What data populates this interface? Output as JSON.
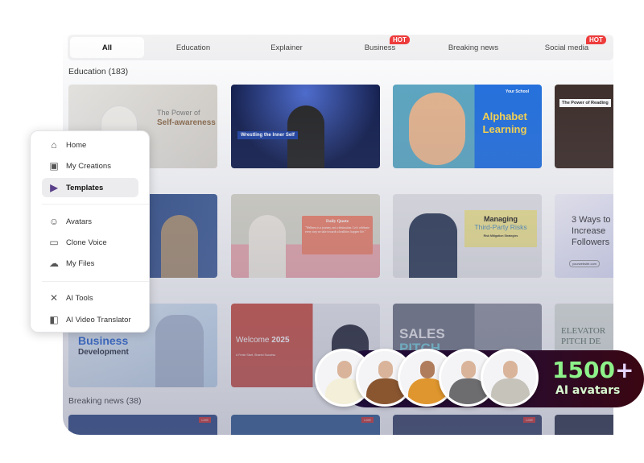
{
  "tabs": [
    {
      "label": "All",
      "active": true
    },
    {
      "label": "Education"
    },
    {
      "label": "Explainer"
    },
    {
      "label": "Business",
      "badge": "HOT"
    },
    {
      "label": "Breaking news"
    },
    {
      "label": "Social media",
      "badge": "HOT"
    }
  ],
  "sections": {
    "education": "Education (183)",
    "breaking": "Breaking news (38)"
  },
  "thumbs": {
    "t1": "The Power of",
    "t1b": "Self-awareness",
    "t2": "Wrestling the Inner Self",
    "t3a": "Your School",
    "t3": "Alphabet Learning",
    "t4": "The Power of Reading",
    "t6": "Daily Quote",
    "t6q": "\"Wellness is a journey, not a destination. Let's celebrate every step we take towards a healthier, happier life.\"",
    "t7a": "Managing",
    "t7b": "Third-Party Risks",
    "t7c": "Risk Mitigation Strategies",
    "t8": "3 Ways to Increase Followers",
    "t8b": "yourwebsite.com",
    "t9a": "Business",
    "t9b": "Development",
    "t10a": "Welcome",
    "t10b": "2025",
    "t10c": "A Fresh Start, Shared Success",
    "t11a": "SALES",
    "t11b": "PITCH",
    "t12": "ELEVATOR PITCH DE",
    "live": "LIVE"
  },
  "menu": {
    "items": [
      {
        "label": "Home",
        "icon": "home-icon"
      },
      {
        "label": "My Creations",
        "icon": "play-icon"
      },
      {
        "label": "Templates",
        "icon": "templates-icon",
        "selected": true
      },
      {
        "label": "Avatars",
        "icon": "avatar-icon"
      },
      {
        "label": "Clone Voice",
        "icon": "voice-icon"
      },
      {
        "label": "My Files",
        "icon": "upload-cloud-icon"
      },
      {
        "label": "AI Tools",
        "icon": "tools-icon"
      },
      {
        "label": "AI Video Translator",
        "icon": "translate-icon"
      }
    ]
  },
  "promo": {
    "count": "1500",
    "plus": "+",
    "label": "AI avatars"
  },
  "colors": {
    "hot": "#ef3b3b",
    "count": "#8ef28a"
  }
}
